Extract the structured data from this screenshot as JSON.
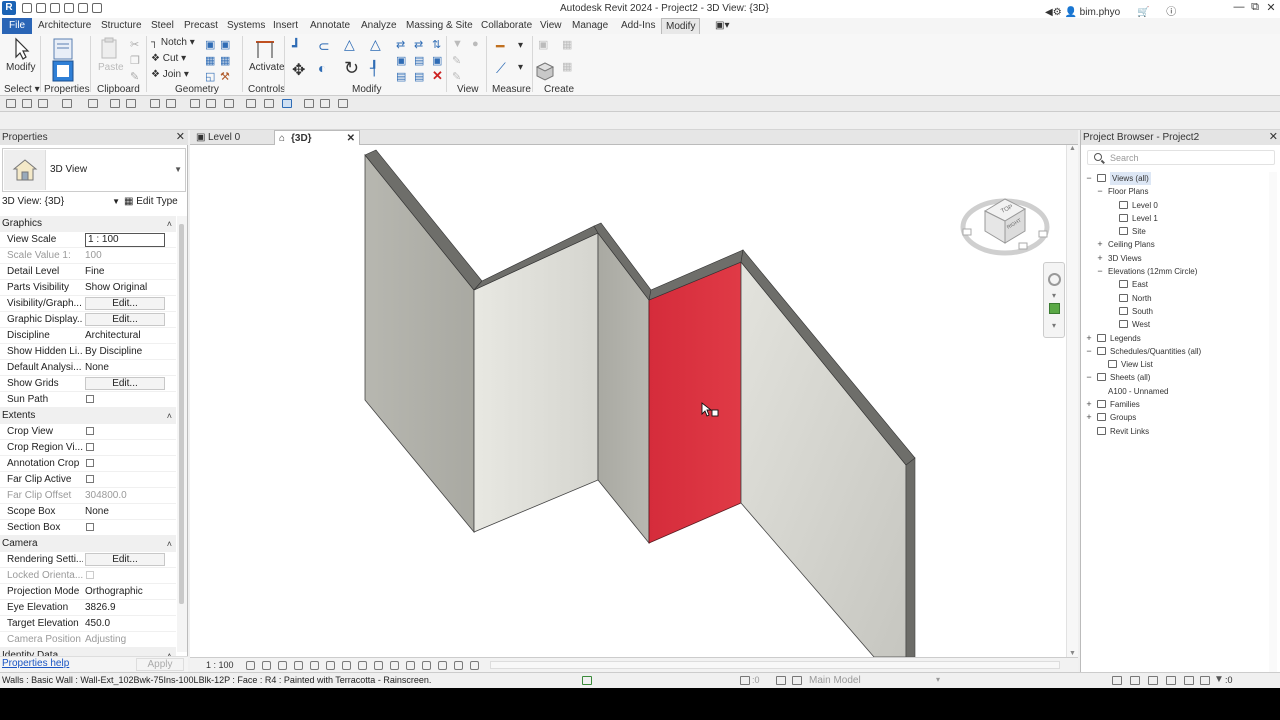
{
  "title": {
    "app_text": "Autodesk Revit 2024 - Project2 - 3D View: {3D}",
    "user": "bim.phyo",
    "logo_letter": "R"
  },
  "menu": {
    "tabs": [
      "File",
      "Architecture",
      "Structure",
      "Steel",
      "Precast",
      "Systems",
      "Insert",
      "Annotate",
      "Analyze",
      "Massing & Site",
      "Collaborate",
      "View",
      "Manage",
      "Add-Ins",
      "Modify"
    ],
    "active": "Modify"
  },
  "ribbon": {
    "modify_label": "Modify",
    "paste_label": "Paste",
    "notch_label": "Notch",
    "cut_label": "Cut",
    "join_label": "Join",
    "activate_label": "Activate",
    "groups": [
      "Select",
      "Properties",
      "Clipboard",
      "Geometry",
      "Controls",
      "Modify",
      "View",
      "Measure",
      "Create"
    ]
  },
  "properties": {
    "title": "Properties",
    "type_name": "3D View",
    "view_selector": "3D View: {3D}",
    "edit_type": "Edit Type",
    "help": "Properties help",
    "apply": "Apply",
    "rows": [
      {
        "kind": "section",
        "label": "Graphics"
      },
      {
        "kind": "field",
        "label": "View Scale",
        "value": "1 : 100"
      },
      {
        "kind": "text",
        "label": "Scale Value    1:",
        "value": "100",
        "dim": true
      },
      {
        "kind": "text",
        "label": "Detail Level",
        "value": "Fine"
      },
      {
        "kind": "text",
        "label": "Parts Visibility",
        "value": "Show Original"
      },
      {
        "kind": "button",
        "label": "Visibility/Graph...",
        "value": "Edit..."
      },
      {
        "kind": "button",
        "label": "Graphic Display...",
        "value": "Edit..."
      },
      {
        "kind": "text",
        "label": "Discipline",
        "value": "Architectural"
      },
      {
        "kind": "text",
        "label": "Show Hidden Li...",
        "value": "By Discipline"
      },
      {
        "kind": "text",
        "label": "Default Analysi...",
        "value": "None"
      },
      {
        "kind": "button",
        "label": "Show Grids",
        "value": "Edit..."
      },
      {
        "kind": "check",
        "label": "Sun Path"
      },
      {
        "kind": "section",
        "label": "Extents"
      },
      {
        "kind": "check",
        "label": "Crop View"
      },
      {
        "kind": "check",
        "label": "Crop Region Vi..."
      },
      {
        "kind": "check",
        "label": "Annotation Crop"
      },
      {
        "kind": "check",
        "label": "Far Clip Active"
      },
      {
        "kind": "text",
        "label": "Far Clip Offset",
        "value": "304800.0",
        "dim": true
      },
      {
        "kind": "text",
        "label": "Scope Box",
        "value": "None"
      },
      {
        "kind": "check",
        "label": "Section Box"
      },
      {
        "kind": "section",
        "label": "Camera"
      },
      {
        "kind": "button",
        "label": "Rendering Setti...",
        "value": "Edit..."
      },
      {
        "kind": "check",
        "label": "Locked Orienta...",
        "dim": true
      },
      {
        "kind": "text",
        "label": "Projection Mode",
        "value": "Orthographic"
      },
      {
        "kind": "text",
        "label": "Eye Elevation",
        "value": "3826.9"
      },
      {
        "kind": "text",
        "label": "Target Elevation",
        "value": "450.0"
      },
      {
        "kind": "text",
        "label": "Camera Position",
        "value": "Adjusting",
        "dim": true
      },
      {
        "kind": "section",
        "label": "Identity Data"
      }
    ]
  },
  "view_tabs": [
    {
      "label": "Level 0",
      "active": false
    },
    {
      "label": "{3D}",
      "active": true
    }
  ],
  "viewcube": {
    "top_label": "TOP",
    "right_label": "RIGHT"
  },
  "view_control": {
    "scale": "1 : 100"
  },
  "browser": {
    "title": "Project Browser - Project2",
    "search_placeholder": "Search",
    "nodes": [
      {
        "depth": 0,
        "toggle": "−",
        "icon": true,
        "label": "Views (all)",
        "selected": true
      },
      {
        "depth": 1,
        "toggle": "−",
        "icon": false,
        "label": "Floor Plans"
      },
      {
        "depth": 2,
        "toggle": "",
        "icon": true,
        "label": "Level 0"
      },
      {
        "depth": 2,
        "toggle": "",
        "icon": true,
        "label": "Level 1"
      },
      {
        "depth": 2,
        "toggle": "",
        "icon": true,
        "label": "Site"
      },
      {
        "depth": 1,
        "toggle": "+",
        "icon": false,
        "label": "Ceiling Plans"
      },
      {
        "depth": 1,
        "toggle": "+",
        "icon": false,
        "label": "3D Views"
      },
      {
        "depth": 1,
        "toggle": "−",
        "icon": false,
        "label": "Elevations (12mm Circle)"
      },
      {
        "depth": 2,
        "toggle": "",
        "icon": true,
        "label": "East"
      },
      {
        "depth": 2,
        "toggle": "",
        "icon": true,
        "label": "North"
      },
      {
        "depth": 2,
        "toggle": "",
        "icon": true,
        "label": "South"
      },
      {
        "depth": 2,
        "toggle": "",
        "icon": true,
        "label": "West"
      },
      {
        "depth": 0,
        "toggle": "+",
        "icon": true,
        "label": "Legends"
      },
      {
        "depth": 0,
        "toggle": "−",
        "icon": true,
        "label": "Schedules/Quantities (all)"
      },
      {
        "depth": 1,
        "toggle": "",
        "icon": true,
        "label": "View List"
      },
      {
        "depth": 0,
        "toggle": "−",
        "icon": true,
        "label": "Sheets (all)"
      },
      {
        "depth": 1,
        "toggle": "",
        "icon": false,
        "label": "A100 - Unnamed"
      },
      {
        "depth": 0,
        "toggle": "+",
        "icon": true,
        "label": "Families"
      },
      {
        "depth": 0,
        "toggle": "+",
        "icon": true,
        "label": "Groups"
      },
      {
        "depth": 0,
        "toggle": "",
        "icon": true,
        "label": "Revit Links"
      }
    ]
  },
  "status": {
    "text": "Walls : Basic Wall : Wall-Ext_102Bwk-75Ins-100LBlk-12P : Face : R4 : Painted with Terracotta - Rainscreen.",
    "model": "Main Model",
    "selected_count": ":0",
    "filter_count": ":0"
  },
  "colors": {
    "accent": "#2a65b6",
    "painted_face": "#d92a3a",
    "wall_light": "#e0e0da",
    "wall_mid": "#b5b5ae",
    "wall_top": "#6e6e6a"
  }
}
